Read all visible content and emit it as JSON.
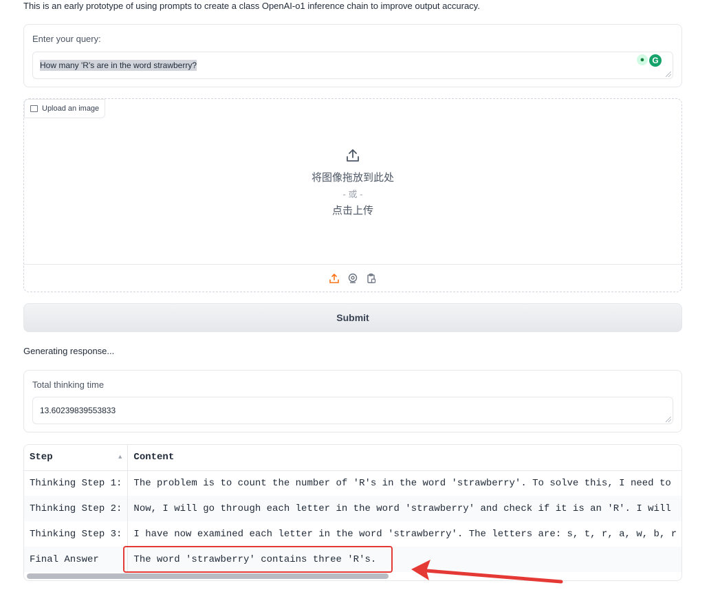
{
  "intro_text": "This is an early prototype of using prompts to create a class OpenAI-o1 inference chain to improve output accuracy.",
  "query": {
    "label": "Enter your query:",
    "value": "How many 'R's are in the word strawberry?",
    "extension_icon": "grammarly-icon"
  },
  "upload": {
    "tag_label": "Upload an image",
    "drop_text": "将图像拖放到此处",
    "or_text": "- 或 -",
    "click_text": "点击上传",
    "footer_icons": [
      "upload-icon",
      "webcam-icon",
      "clipboard-icon"
    ]
  },
  "submit_label": "Submit",
  "status_text": "Generating response...",
  "thinking": {
    "label": "Total thinking time",
    "value": "13.60239839553833"
  },
  "table": {
    "headers": [
      "Step",
      "Content"
    ],
    "rows": [
      [
        "Thinking Step 1:",
        "The problem is to count the number of 'R's in the word 'strawberry'. To solve this, I need to"
      ],
      [
        "Thinking Step 2:",
        "Now, I will go through each letter in the word 'strawberry' and check if it is an 'R'. I will"
      ],
      [
        "Thinking Step 3:",
        "I have now examined each letter in the word 'strawberry'. The letters are: s, t, r, a, w, b, r"
      ],
      [
        "Final Answer",
        "The word 'strawberry' contains three 'R's."
      ]
    ]
  },
  "colors": {
    "annotation": "#e53935",
    "upload_accent": "#f97316"
  }
}
